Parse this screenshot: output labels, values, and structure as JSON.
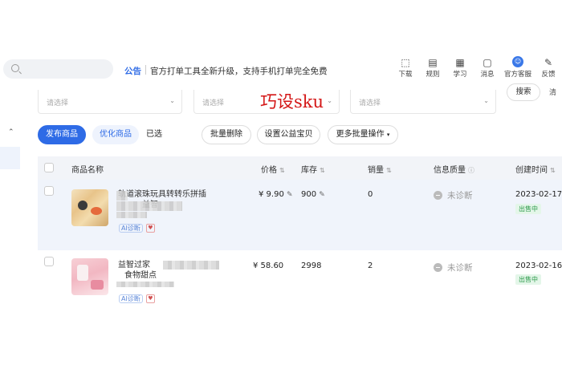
{
  "topbar": {
    "search_placeholder": "",
    "notice_label": "公告",
    "notice_text": "官方打单工具全新升级，支持手机打单完全免费",
    "tools": [
      {
        "label": "下载",
        "icon": "download-icon"
      },
      {
        "label": "规则",
        "icon": "rules-icon"
      },
      {
        "label": "学习",
        "icon": "learn-icon"
      },
      {
        "label": "消息",
        "icon": "message-icon"
      },
      {
        "label": "官方客服",
        "icon": "customer-service-icon"
      },
      {
        "label": "反馈",
        "icon": "feedback-icon"
      }
    ]
  },
  "filters": {
    "select1": "请选择",
    "select2": "请选择",
    "select3": "请选择",
    "search_button": "搜索",
    "clear_button": "清"
  },
  "overlay_text": "巧设sku",
  "actions": {
    "publish": "发布商品",
    "optimize": "优化商品",
    "selected": "已选",
    "batch_delete": "批量删除",
    "set_welfare": "设置公益宝贝",
    "more_batch": "更多批量操作"
  },
  "table": {
    "headers": {
      "name": "商品名称",
      "price": "价格",
      "stock": "库存",
      "sales": "销量",
      "quality": "信息质量",
      "created": "创建时间"
    },
    "rows": [
      {
        "title": "轨道滚珠玩具转转乐拼插",
        "subtitle": "益智",
        "ai_tag": "AI诊断",
        "price": "¥ 9.90",
        "stock": "900",
        "sales": "0",
        "quality": "未诊断",
        "date": "2023-02-17",
        "status": "出售中"
      },
      {
        "title": "益智过家",
        "subtitle": "食物甜点",
        "ai_tag": "AI诊断",
        "price": "¥ 58.60",
        "stock": "2998",
        "sales": "2",
        "quality": "未诊断",
        "date": "2023-02-16",
        "status": "出售中"
      }
    ]
  },
  "colors": {
    "accent": "#2e6be6",
    "overlay": "#d41616",
    "status": "#2c9a4a"
  }
}
